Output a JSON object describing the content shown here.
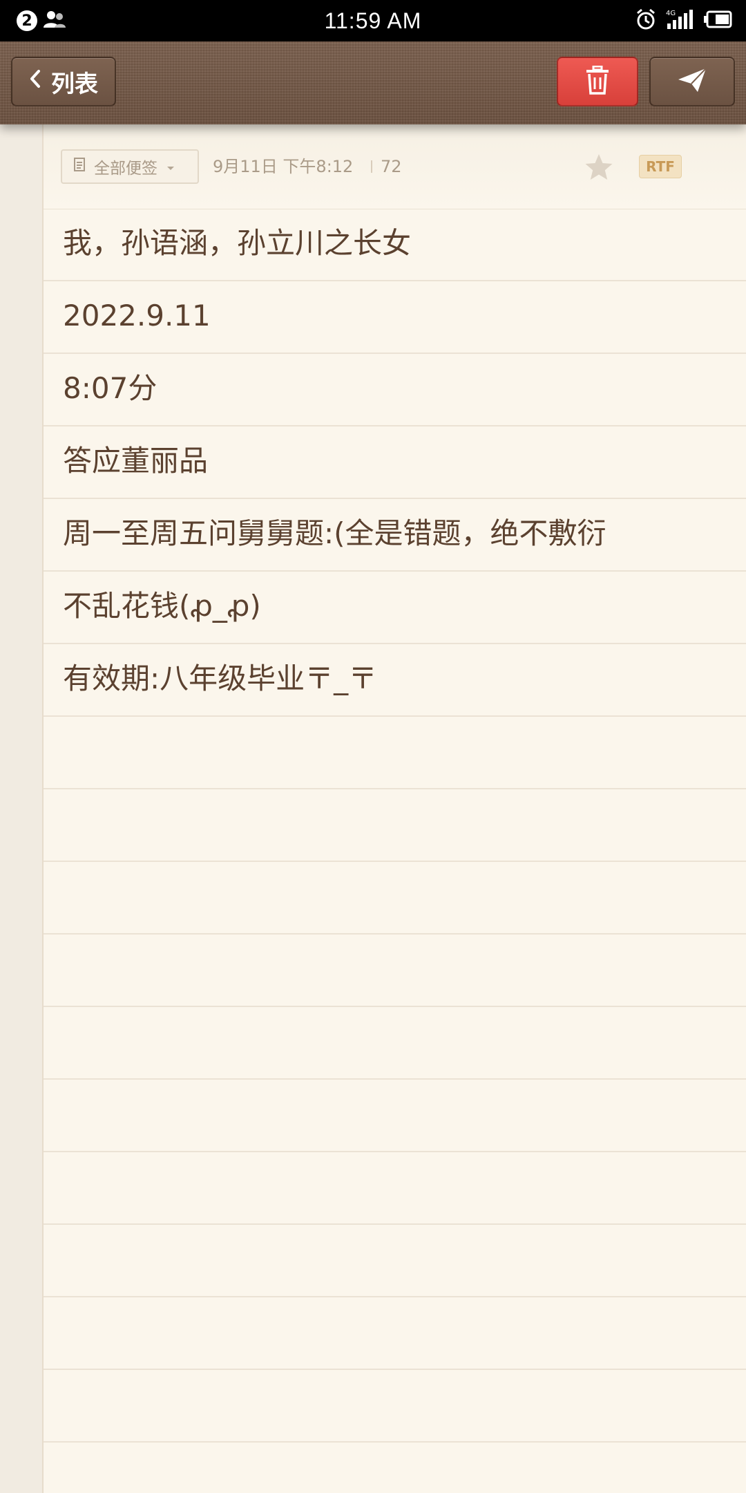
{
  "status_bar": {
    "notification_count": "2",
    "time": "11:59 AM",
    "network": "4G"
  },
  "toolbar": {
    "back_label": "列表"
  },
  "meta": {
    "folder": "全部便签",
    "date": "9月11日 下午8:12",
    "char_count": "72",
    "format_badge": "RTF"
  },
  "note": {
    "lines": [
      "我，孙语涵，孙立川之长女",
      "2022.9.11",
      "8:07分",
      "答应董丽品",
      "周一至周五问舅舅题:(全是错题，绝不敷衍",
      "不乱花钱(ꝓ_ꝓ)",
      "有效期:八年级毕业〒_〒"
    ]
  },
  "colors": {
    "toolbar_bg": "#6f5443",
    "delete_red": "#e04a44",
    "paper": "#fbf6ec",
    "text": "#5b412f"
  }
}
